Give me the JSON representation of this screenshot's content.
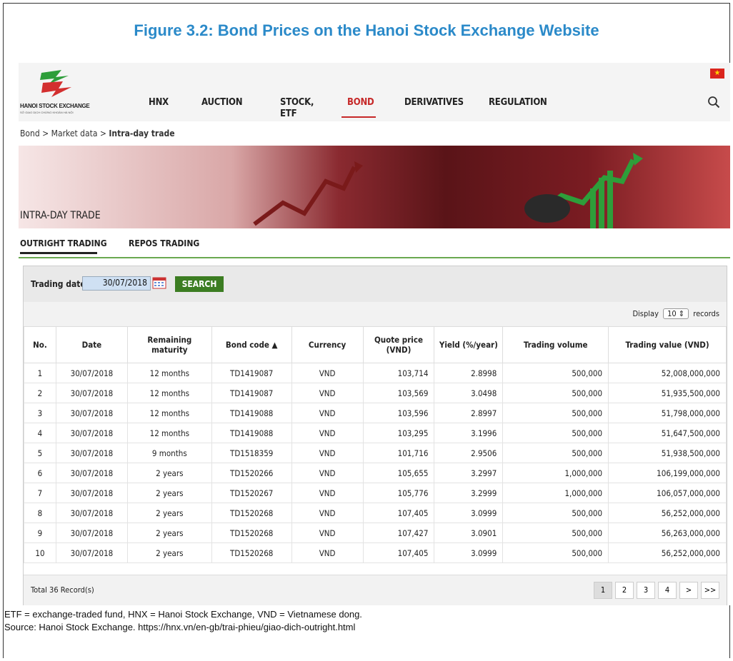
{
  "figure_title": "Figure 3.2: Bond Prices on the Hanoi Stock Exchange Website",
  "header": {
    "logo_text": "HANOI STOCK EXCHANGE",
    "logo_subtext": "SỞ GIAO DỊCH CHỨNG KHOÁN HÀ NỘI",
    "nav": {
      "hnx": "HNX",
      "auction": "AUCTION",
      "stock_etf": "STOCK, ETF",
      "bond": "BOND",
      "derivatives": "DERIVATIVES",
      "regulation": "REGULATION"
    },
    "flag_symbol": "★",
    "search_icon": "search-icon"
  },
  "breadcrumb": {
    "part1": "Bond",
    "sep1": ">",
    "part2": "Market data",
    "sep2": ">",
    "current": "Intra-day trade"
  },
  "banner": {
    "title": "INTRA-DAY TRADE"
  },
  "tabs": {
    "outright": "OUTRIGHT TRADING",
    "repos": "REPOS TRADING"
  },
  "filter": {
    "label": "Trading date",
    "date_value": "30/07/2018",
    "search_label": "SEARCH"
  },
  "display": {
    "prefix": "Display",
    "value": "10 ⇕",
    "suffix": "records"
  },
  "table": {
    "headers": {
      "no": "No.",
      "date": "Date",
      "maturity": "Remaining maturity",
      "bond_code": "Bond code ▲",
      "currency": "Currency",
      "quote_price": "Quote price (VND)",
      "yield": "Yield (%/year)",
      "volume": "Trading volume",
      "value": "Trading value (VND)"
    },
    "rows": [
      {
        "no": "1",
        "date": "30/07/2018",
        "maturity": "12 months",
        "code": "TD1419087",
        "currency": "VND",
        "price": "103,714",
        "yield": "2.8998",
        "volume": "500,000",
        "value": "52,008,000,000"
      },
      {
        "no": "2",
        "date": "30/07/2018",
        "maturity": "12 months",
        "code": "TD1419087",
        "currency": "VND",
        "price": "103,569",
        "yield": "3.0498",
        "volume": "500,000",
        "value": "51,935,500,000"
      },
      {
        "no": "3",
        "date": "30/07/2018",
        "maturity": "12 months",
        "code": "TD1419088",
        "currency": "VND",
        "price": "103,596",
        "yield": "2.8997",
        "volume": "500,000",
        "value": "51,798,000,000"
      },
      {
        "no": "4",
        "date": "30/07/2018",
        "maturity": "12 months",
        "code": "TD1419088",
        "currency": "VND",
        "price": "103,295",
        "yield": "3.1996",
        "volume": "500,000",
        "value": "51,647,500,000"
      },
      {
        "no": "5",
        "date": "30/07/2018",
        "maturity": "9 months",
        "code": "TD1518359",
        "currency": "VND",
        "price": "101,716",
        "yield": "2.9506",
        "volume": "500,000",
        "value": "51,938,500,000"
      },
      {
        "no": "6",
        "date": "30/07/2018",
        "maturity": "2 years",
        "code": "TD1520266",
        "currency": "VND",
        "price": "105,655",
        "yield": "3.2997",
        "volume": "1,000,000",
        "value": "106,199,000,000"
      },
      {
        "no": "7",
        "date": "30/07/2018",
        "maturity": "2 years",
        "code": "TD1520267",
        "currency": "VND",
        "price": "105,776",
        "yield": "3.2999",
        "volume": "1,000,000",
        "value": "106,057,000,000"
      },
      {
        "no": "8",
        "date": "30/07/2018",
        "maturity": "2 years",
        "code": "TD1520268",
        "currency": "VND",
        "price": "107,405",
        "yield": "3.0999",
        "volume": "500,000",
        "value": "56,252,000,000"
      },
      {
        "no": "9",
        "date": "30/07/2018",
        "maturity": "2 years",
        "code": "TD1520268",
        "currency": "VND",
        "price": "107,427",
        "yield": "3.0901",
        "volume": "500,000",
        "value": "56,263,000,000"
      },
      {
        "no": "10",
        "date": "30/07/2018",
        "maturity": "2 years",
        "code": "TD1520268",
        "currency": "VND",
        "price": "107,405",
        "yield": "3.0999",
        "volume": "500,000",
        "value": "56,252,000,000"
      }
    ]
  },
  "footer": {
    "total": "Total 36 Record(s)",
    "pages": [
      "1",
      "2",
      "3",
      "4",
      ">",
      ">>"
    ]
  },
  "notes": {
    "line1": "ETF = exchange-traded fund, HNX = Hanoi Stock Exchange, VND = Vietnamese dong.",
    "line2": "Source: Hanoi Stock Exchange. https://hnx.vn/en-gb/trai-phieu/giao-dich-outright.html"
  },
  "colors": {
    "title_blue": "#2b8ac9",
    "bond_red": "#c62828",
    "search_green": "#3c7d22",
    "tab_line_green": "#6aa84f"
  }
}
